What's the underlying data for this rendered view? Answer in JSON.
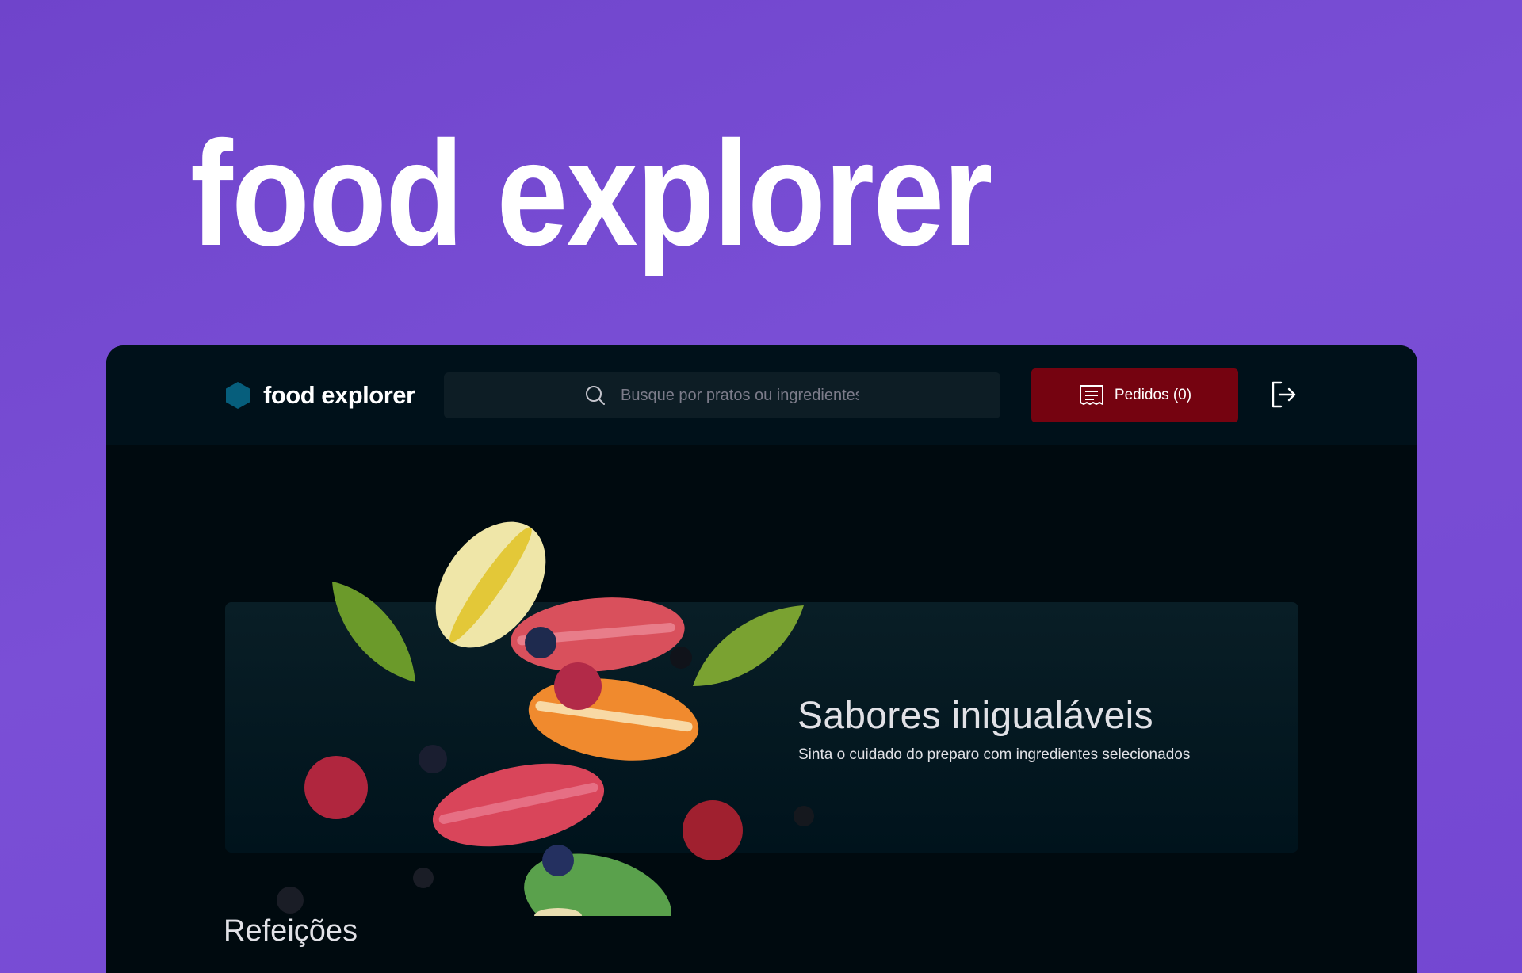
{
  "hero": {
    "title": "food explorer"
  },
  "header": {
    "logo_text": "food explorer",
    "search_placeholder": "Busque por pratos ou ingredientes",
    "orders_label": "Pedidos (0)"
  },
  "banner": {
    "title": "Sabores inigualáveis",
    "subtitle": "Sinta o cuidado do preparo com ingredientes selecionados"
  },
  "sections": [
    {
      "title": "Refeições"
    }
  ],
  "colors": {
    "background": "#7447d2",
    "app_background": "#000a0f",
    "header_background": "#00111a",
    "accent_button": "#750310",
    "logo_hex": "#065e7c"
  },
  "icons": [
    "hexagon-logo-icon",
    "search-icon",
    "receipt-icon",
    "logout-icon"
  ]
}
